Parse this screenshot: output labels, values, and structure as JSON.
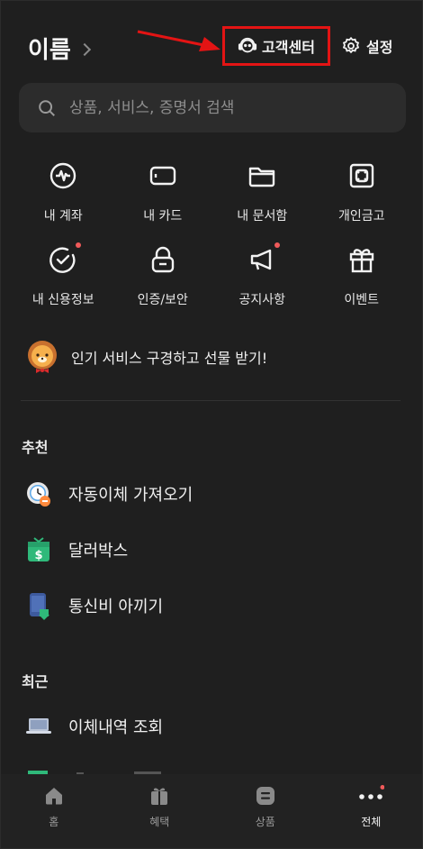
{
  "header": {
    "profile_name": "이름",
    "customer_center_label": "고객센터",
    "settings_label": "설정"
  },
  "search": {
    "placeholder": "상품, 서비스, 증명서 검색"
  },
  "quick_menu": [
    {
      "label": "내 계좌",
      "icon": "account-icon",
      "badge": false
    },
    {
      "label": "내 카드",
      "icon": "card-icon",
      "badge": false
    },
    {
      "label": "내 문서함",
      "icon": "folder-icon",
      "badge": false
    },
    {
      "label": "개인금고",
      "icon": "safe-icon",
      "badge": false
    },
    {
      "label": "내 신용정보",
      "icon": "credit-check-icon",
      "badge": true
    },
    {
      "label": "인증/보안",
      "icon": "lock-icon",
      "badge": false
    },
    {
      "label": "공지사항",
      "icon": "megaphone-icon",
      "badge": true
    },
    {
      "label": "이벤트",
      "icon": "gift-icon",
      "badge": false
    }
  ],
  "promo": {
    "text": "인기 서비스 구경하고 선물 받기!",
    "icon": "lion-character-icon"
  },
  "recommended": {
    "title": "추천",
    "items": [
      {
        "label": "자동이체 가져오기",
        "icon": "clock-transfer-icon"
      },
      {
        "label": "달러박스",
        "icon": "dollar-box-icon"
      },
      {
        "label": "통신비 아끼기",
        "icon": "phone-saving-icon"
      }
    ]
  },
  "recent": {
    "title": "최근",
    "items": [
      {
        "label": "이체내역 조회",
        "icon": "laptop-icon"
      }
    ]
  },
  "bottom_nav": {
    "items": [
      {
        "label": "홈",
        "icon": "home-icon",
        "active": false
      },
      {
        "label": "혜택",
        "icon": "benefit-icon",
        "active": false
      },
      {
        "label": "상품",
        "icon": "products-icon",
        "active": false
      },
      {
        "label": "전체",
        "icon": "more-icon",
        "active": true,
        "badge": true
      }
    ]
  },
  "colors": {
    "background": "#1f1f1f",
    "search_bg": "#2c2c2c",
    "badge": "#f05a5a",
    "highlight_border": "#e31414"
  }
}
